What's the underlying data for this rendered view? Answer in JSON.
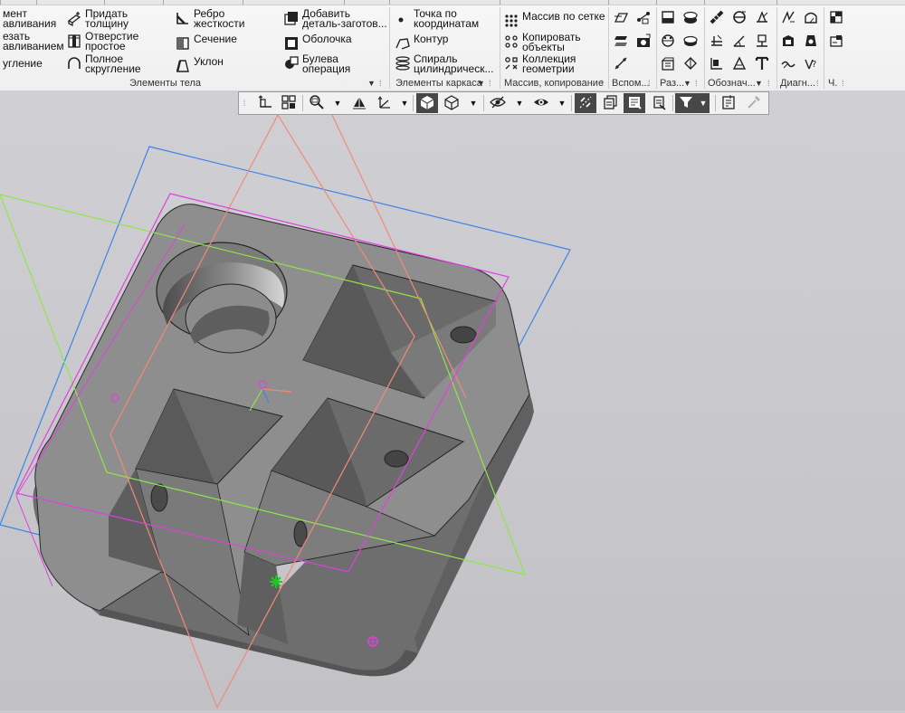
{
  "ribbon": {
    "elements_tela": {
      "group_label": "Элементы тела",
      "col1": [
        {
          "label": "мент\nавливания",
          "icon": "extrude-icon"
        },
        {
          "label": "езать\nавливанием",
          "icon": "cut-extrude-icon"
        },
        {
          "label": "угление",
          "icon": "fillet-icon"
        }
      ],
      "col2": [
        {
          "label": "Придать\nтолщину",
          "icon": "thicken-icon"
        },
        {
          "label": "Отверстие\nпростое",
          "icon": "hole-icon"
        },
        {
          "label": "Полное\nскругление",
          "icon": "full-round-icon"
        }
      ],
      "col3": [
        {
          "label": "Ребро\nжесткости",
          "icon": "rib-icon"
        },
        {
          "label": "Сечение",
          "icon": "section-icon"
        },
        {
          "label": "Уклон",
          "icon": "draft-icon"
        }
      ],
      "col4": [
        {
          "label": "Добавить\nдеталь-заготов...",
          "icon": "add-blank-part-icon"
        },
        {
          "label": "Оболочка",
          "icon": "shell-icon"
        },
        {
          "label": "Булева\nоперация",
          "icon": "boolean-icon"
        }
      ]
    },
    "elements_karkasa": {
      "group_label": "Элементы каркаса",
      "items": [
        {
          "label": "Точка по\nкоординатам",
          "icon": "point-by-coordinates-icon"
        },
        {
          "label": "Контур",
          "icon": "contour-icon"
        },
        {
          "label": "Спираль\nцилиндрическ...",
          "icon": "cylindrical-spiral-icon"
        }
      ]
    },
    "massiv": {
      "group_label": "Массив, копирование",
      "items": [
        {
          "label": "Массив по сетке",
          "icon": "grid-array-icon"
        },
        {
          "label": "Копировать\nобъекты",
          "icon": "copy-objects-icon"
        },
        {
          "label": "Коллекция\nгеометрии",
          "icon": "geometry-collection-icon"
        }
      ]
    },
    "small_group_labels": {
      "vspom": "Вспом...",
      "raz": "Раз...",
      "oboznach": "Обознач...",
      "diagn": "Диагн...",
      "ch": "Ч."
    }
  },
  "context_toolbar": {
    "buttons": [
      {
        "name": "sketch-icon"
      },
      {
        "name": "filter-objects-icon"
      },
      {
        "name": "zoom-icon"
      },
      {
        "name": "orient-view-icon"
      },
      {
        "name": "axis-orientation-icon"
      },
      {
        "name": "shaded-display-icon",
        "active": true
      },
      {
        "name": "wireframe-display-icon"
      },
      {
        "name": "visibility-icon"
      },
      {
        "name": "section-view-icon"
      },
      {
        "name": "snap-points-icon",
        "active": true
      },
      {
        "name": "layers-icon"
      },
      {
        "name": "show-all-icon",
        "active": true
      },
      {
        "name": "hide-icon"
      },
      {
        "name": "selection-filter-icon",
        "active": true
      },
      {
        "name": "properties-panel-icon"
      },
      {
        "name": "eyedropper-icon"
      }
    ]
  },
  "colors": {
    "viewport_bg": "#c9c9cd",
    "part_face": "#8c8c8c",
    "part_dark": "#5a5a5a",
    "plane_blue": "#3d84e8",
    "plane_green": "#8ee64a",
    "plane_salmon": "#f08a7a",
    "plane_magenta": "#e040e0",
    "active_button": "#474747"
  }
}
